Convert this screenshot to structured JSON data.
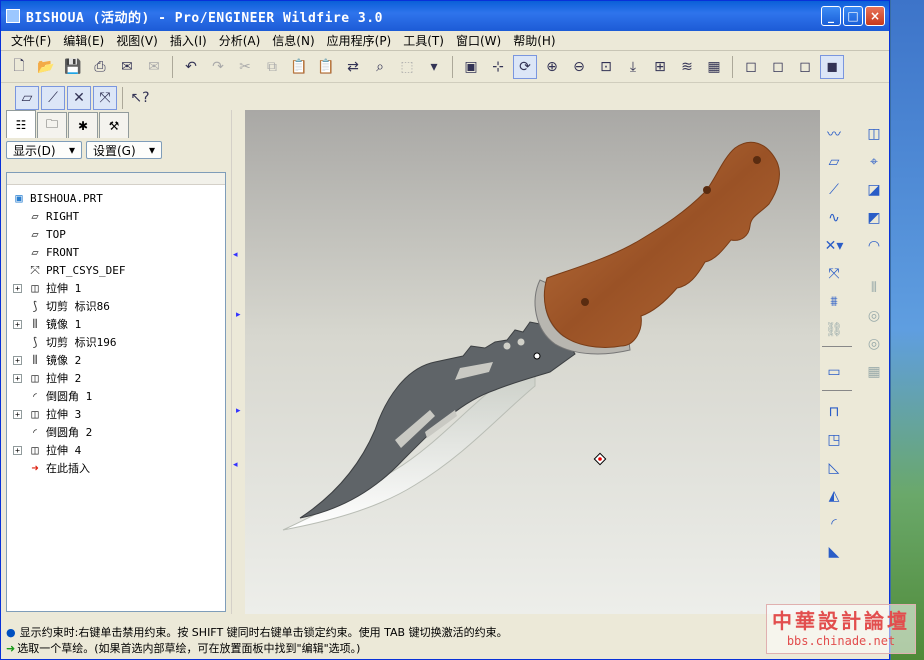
{
  "window": {
    "title": "BISHOUA (活动的) - Pro/ENGINEER Wildfire 3.0",
    "min": "_",
    "max": "□",
    "close": "×"
  },
  "menu": [
    "文件(F)",
    "编辑(E)",
    "视图(V)",
    "插入(I)",
    "分析(A)",
    "信息(N)",
    "应用程序(P)",
    "工具(T)",
    "窗口(W)",
    "帮助(H)"
  ],
  "panel": {
    "show_btn": "显示(D)",
    "settings_btn": "设置(G)",
    "tree": [
      {
        "label": "BISHOUA.PRT",
        "icon": "part-icon",
        "expand": false,
        "indent": 0
      },
      {
        "label": "RIGHT",
        "icon": "datum-plane-icon",
        "expand": false,
        "indent": 1
      },
      {
        "label": "TOP",
        "icon": "datum-plane-icon",
        "expand": false,
        "indent": 1
      },
      {
        "label": "FRONT",
        "icon": "datum-plane-icon",
        "expand": false,
        "indent": 1
      },
      {
        "label": "PRT_CSYS_DEF",
        "icon": "csys-icon",
        "expand": false,
        "indent": 1
      },
      {
        "label": "拉伸 1",
        "icon": "extrude-icon",
        "expand": true,
        "indent": 1
      },
      {
        "label": "切剪 标识86",
        "icon": "cut-icon",
        "expand": false,
        "indent": 1
      },
      {
        "label": "镜像 1",
        "icon": "mirror-icon",
        "expand": true,
        "indent": 1
      },
      {
        "label": "切剪 标识196",
        "icon": "cut-icon",
        "expand": false,
        "indent": 1
      },
      {
        "label": "镜像 2",
        "icon": "mirror-icon",
        "expand": true,
        "indent": 1
      },
      {
        "label": "拉伸 2",
        "icon": "extrude-icon",
        "expand": true,
        "indent": 1
      },
      {
        "label": "倒圆角 1",
        "icon": "round-icon",
        "expand": false,
        "indent": 1
      },
      {
        "label": "拉伸 3",
        "icon": "extrude-icon",
        "expand": true,
        "indent": 1
      },
      {
        "label": "倒圆角 2",
        "icon": "round-icon",
        "expand": false,
        "indent": 1
      },
      {
        "label": "拉伸 4",
        "icon": "extrude-icon",
        "expand": true,
        "indent": 1
      },
      {
        "label": "在此插入",
        "icon": "insert-here-icon",
        "expand": false,
        "indent": 1
      }
    ]
  },
  "status": {
    "line1": "显示约束时:右键单击禁用约束。按 SHIFT 键同时右键单击锁定约束。使用 TAB 键切换激活的约束。",
    "line2": "选取一个草绘。(如果首选内部草绘，可在放置面板中找到\"编辑\"选项。)"
  },
  "watermark": {
    "line1": "中華設計論壇",
    "line2": "bbs.chinade.net"
  },
  "colors": {
    "handle": "#a0582a",
    "blade": "#606468",
    "edge": "#f2f4ee"
  }
}
